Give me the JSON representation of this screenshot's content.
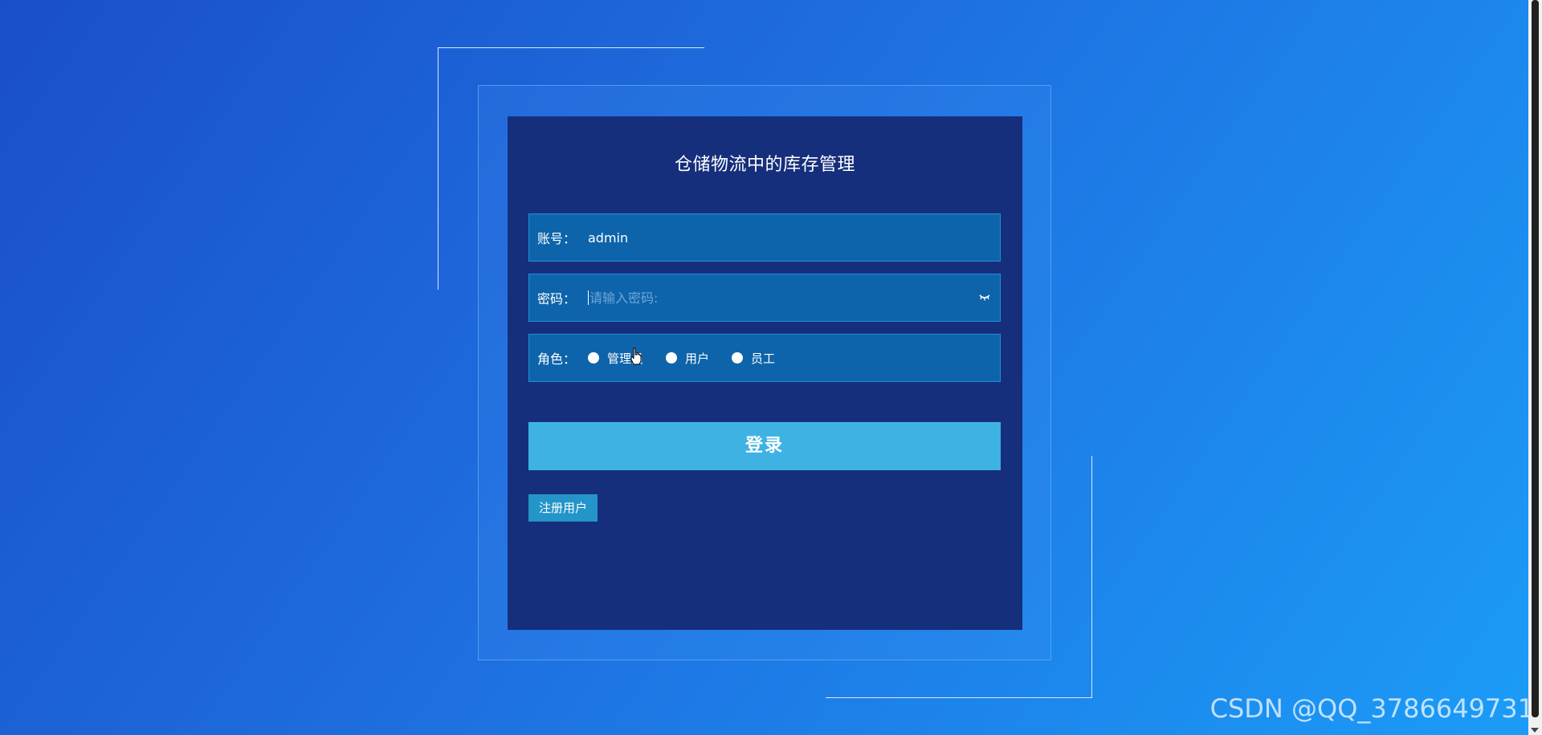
{
  "login": {
    "title": "仓储物流中的库存管理",
    "account": {
      "label": "账号：",
      "value": "admin"
    },
    "password": {
      "label": "密码：",
      "placeholder": "请输入密码:",
      "toggle_icon": "eye-closed-icon"
    },
    "role": {
      "label": "角色：",
      "options": [
        "管理员",
        "用户",
        "员工"
      ]
    },
    "login_label": "登录",
    "register_label": "注册用户"
  },
  "watermark": "CSDN @QQ_3786649731",
  "colors": {
    "card_background": "#162f7c",
    "field_background": "#0e64aa",
    "login_button": "#3eb3e3",
    "register_button": "#2395c9",
    "page_gradient_start": "#1a4fc9",
    "page_gradient_end": "#1b9cf7"
  }
}
